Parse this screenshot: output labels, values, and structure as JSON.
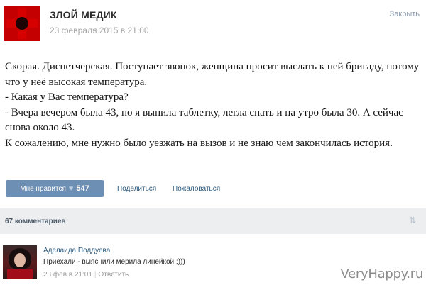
{
  "post": {
    "author": "ЗЛОЙ МЕДИК",
    "date": "23 февраля 2015 в 21:00",
    "close_label": "Закрыть",
    "avatar_icon": "red-cross-icon",
    "text_lines": [
      "Скорая. Диспетчерская. Поступает звонок, женщина просит выслать к ней бригаду, потому что у неё высокая температура.",
      "- Какая у Вас температура?",
      "- Вчера вечером была 43, но я выпила таблетку, легла спать и на утро была 30. А сейчас снова около 43.",
      "К сожалению, мне нужно было уезжать на вызов и не знаю чем закончилась история."
    ]
  },
  "actions": {
    "like_label": "Мне нравится",
    "like_icon": "heart-icon",
    "like_count": "547",
    "share_label": "Поделиться",
    "report_label": "Пожаловаться"
  },
  "comments": {
    "count_label": "67 комментариев",
    "sort_icon": "sort-arrows-icon",
    "items": [
      {
        "author": "Аделаида Поддуева",
        "text": "Приехали - выяснили мерила линейкой ;)))",
        "time": "23 фев в 21:01",
        "separator": "|",
        "reply_label": "Ответить"
      }
    ]
  },
  "watermark": "VeryHappy.ru",
  "colors": {
    "accent_button": "#6d8fb3",
    "link": "#2b587a",
    "comments_bar": "#edeef0"
  }
}
